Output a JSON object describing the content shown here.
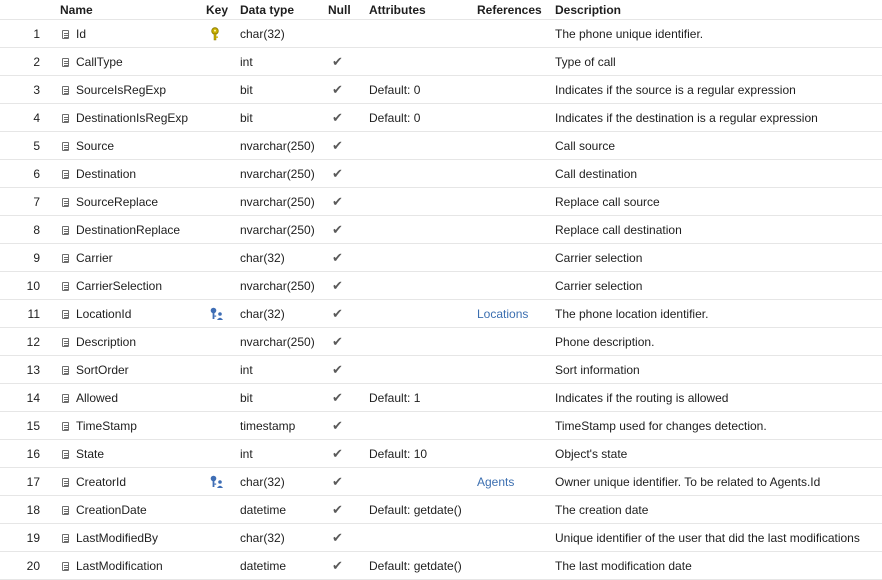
{
  "columns": {
    "name": "Name",
    "key": "Key",
    "data_type": "Data type",
    "null": "Null",
    "attributes": "Attributes",
    "references": "References",
    "description": "Description"
  },
  "icons": {
    "column": "column-icon",
    "primary_key": "primary-key-icon",
    "foreign_key": "foreign-key-icon",
    "null_check": "check-icon"
  },
  "colors": {
    "link": "#3c6fb0",
    "primary_key": "#c9b000",
    "foreign_key": "#3f6eb5",
    "grid": "#e6e6e6"
  },
  "rows": [
    {
      "num": "1",
      "name": "Id",
      "key": "pk",
      "type": "char(32)",
      "null": "",
      "attributes": "",
      "references": "",
      "description": "The phone unique identifier."
    },
    {
      "num": "2",
      "name": "CallType",
      "key": "",
      "type": "int",
      "null": "✔",
      "attributes": "",
      "references": "",
      "description": "Type of call"
    },
    {
      "num": "3",
      "name": "SourceIsRegExp",
      "key": "",
      "type": "bit",
      "null": "✔",
      "attributes": "Default: 0",
      "references": "",
      "description": "Indicates if the source is a regular expression"
    },
    {
      "num": "4",
      "name": "DestinationIsRegExp",
      "key": "",
      "type": "bit",
      "null": "✔",
      "attributes": "Default: 0",
      "references": "",
      "description": "Indicates if the destination is a regular expression"
    },
    {
      "num": "5",
      "name": "Source",
      "key": "",
      "type": "nvarchar(250)",
      "null": "✔",
      "attributes": "",
      "references": "",
      "description": "Call source"
    },
    {
      "num": "6",
      "name": "Destination",
      "key": "",
      "type": "nvarchar(250)",
      "null": "✔",
      "attributes": "",
      "references": "",
      "description": "Call destination"
    },
    {
      "num": "7",
      "name": "SourceReplace",
      "key": "",
      "type": "nvarchar(250)",
      "null": "✔",
      "attributes": "",
      "references": "",
      "description": "Replace call source"
    },
    {
      "num": "8",
      "name": "DestinationReplace",
      "key": "",
      "type": "nvarchar(250)",
      "null": "✔",
      "attributes": "",
      "references": "",
      "description": "Replace call destination"
    },
    {
      "num": "9",
      "name": "Carrier",
      "key": "",
      "type": "char(32)",
      "null": "✔",
      "attributes": "",
      "references": "",
      "description": "Carrier selection"
    },
    {
      "num": "10",
      "name": "CarrierSelection",
      "key": "",
      "type": "nvarchar(250)",
      "null": "✔",
      "attributes": "",
      "references": "",
      "description": "Carrier selection"
    },
    {
      "num": "11",
      "name": "LocationId",
      "key": "fk",
      "type": "char(32)",
      "null": "✔",
      "attributes": "",
      "references": "Locations",
      "description": "The phone location identifier."
    },
    {
      "num": "12",
      "name": "Description",
      "key": "",
      "type": "nvarchar(250)",
      "null": "✔",
      "attributes": "",
      "references": "",
      "description": "Phone description."
    },
    {
      "num": "13",
      "name": "SortOrder",
      "key": "",
      "type": "int",
      "null": "✔",
      "attributes": "",
      "references": "",
      "description": "Sort information"
    },
    {
      "num": "14",
      "name": "Allowed",
      "key": "",
      "type": "bit",
      "null": "✔",
      "attributes": "Default: 1",
      "references": "",
      "description": "Indicates if the routing is allowed"
    },
    {
      "num": "15",
      "name": "TimeStamp",
      "key": "",
      "type": "timestamp",
      "null": "✔",
      "attributes": "",
      "references": "",
      "description": "TimeStamp used for changes detection."
    },
    {
      "num": "16",
      "name": "State",
      "key": "",
      "type": "int",
      "null": "✔",
      "attributes": "Default: 10",
      "references": "",
      "description": "Object's state"
    },
    {
      "num": "17",
      "name": "CreatorId",
      "key": "fk",
      "type": "char(32)",
      "null": "✔",
      "attributes": "",
      "references": "Agents",
      "description": "Owner unique identifier. To be related to Agents.Id"
    },
    {
      "num": "18",
      "name": "CreationDate",
      "key": "",
      "type": "datetime",
      "null": "✔",
      "attributes": "Default: getdate()",
      "references": "",
      "description": "The creation date"
    },
    {
      "num": "19",
      "name": "LastModifiedBy",
      "key": "",
      "type": "char(32)",
      "null": "✔",
      "attributes": "",
      "references": "",
      "description": "Unique identifier of the user that did the last modifications"
    },
    {
      "num": "20",
      "name": "LastModification",
      "key": "",
      "type": "datetime",
      "null": "✔",
      "attributes": "Default: getdate()",
      "references": "",
      "description": "The last modification date"
    }
  ]
}
